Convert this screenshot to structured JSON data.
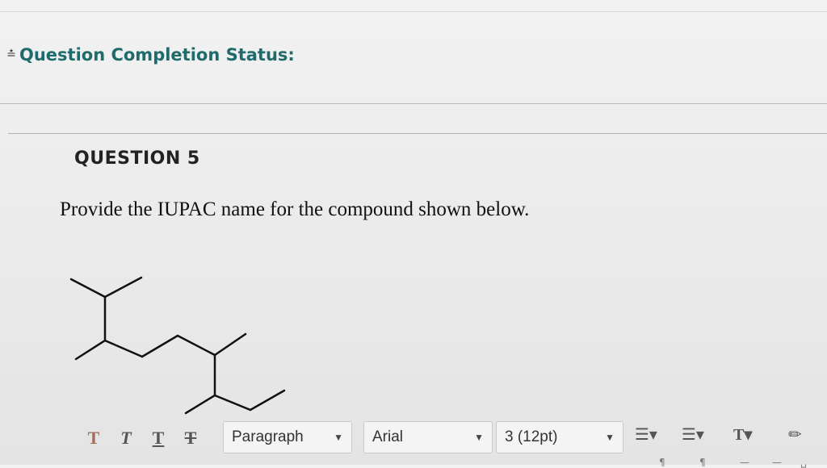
{
  "status": {
    "label": "Question Completion Status:"
  },
  "question": {
    "heading": "QUESTION 5",
    "prompt": "Provide the IUPAC name for the compound shown below."
  },
  "editor_toolbar": {
    "block_format": "Paragraph",
    "font_family": "Arial",
    "font_size": "3 (12pt)",
    "format_buttons": [
      "T",
      "T",
      "T",
      "T"
    ]
  },
  "icons": [
    "chevron-collapse-icon",
    "bold-icon",
    "italic-icon",
    "underline-icon",
    "strikethrough-icon",
    "bullet-list-icon",
    "numbered-list-icon",
    "text-color-icon",
    "highlighter-icon"
  ]
}
